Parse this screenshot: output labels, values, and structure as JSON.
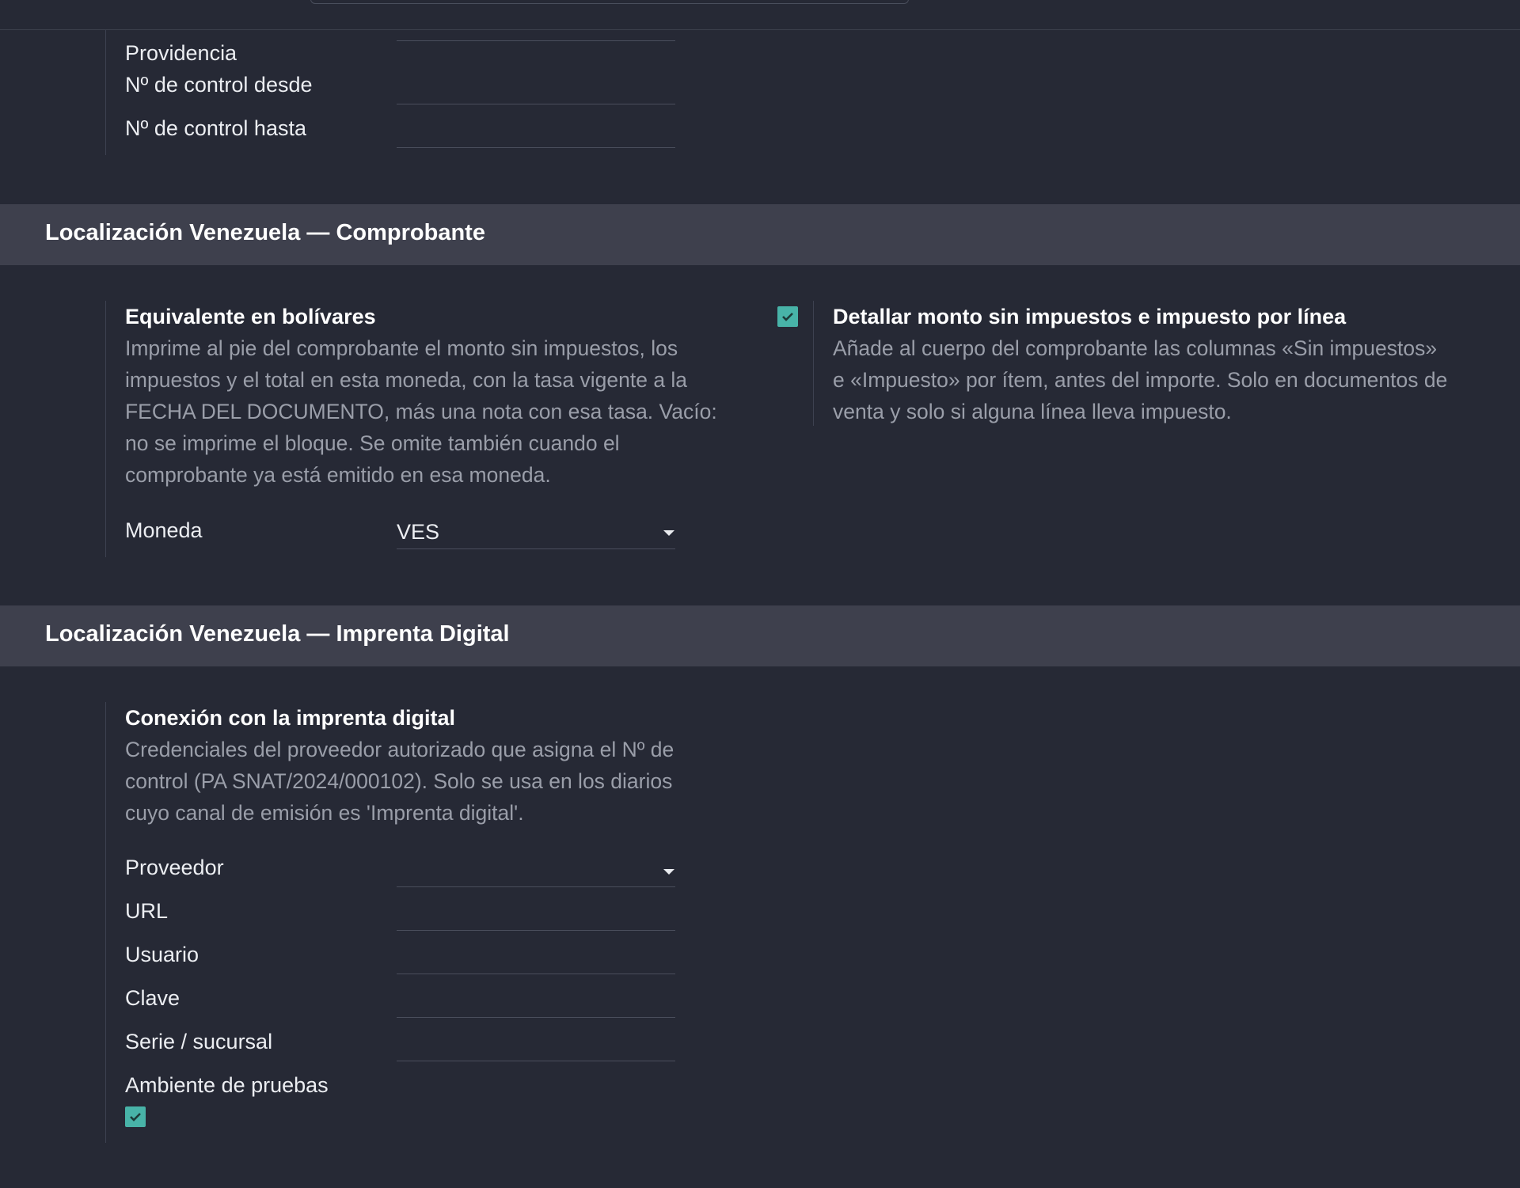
{
  "top_fields": [
    {
      "label": "Providencia"
    },
    {
      "label": "Nº de control desde"
    },
    {
      "label": "Nº de control hasta"
    }
  ],
  "section_comprobante": {
    "header": "Localización Venezuela — Comprobante",
    "bolivares": {
      "title": "Equivalente en bolívares",
      "description": "Imprime al pie del comprobante el monto sin impuestos, los impuestos y el total en esta moneda, con la tasa vigente a la FECHA DEL DOCUMENTO, más una nota con esa tasa. Vacío: no se imprime el bloque. Se omite también cuando el comprobante ya está emitido en esa moneda.",
      "currency_label": "Moneda",
      "currency_value": "VES"
    },
    "detallar": {
      "checked": true,
      "title": "Detallar monto sin impuestos e impuesto por línea",
      "description": "Añade al cuerpo del comprobante las columnas «Sin impuestos» e «Impuesto» por ítem, antes del importe. Solo en documentos de venta y solo si alguna línea lleva impuesto."
    }
  },
  "section_imprenta": {
    "header": "Localización Venezuela — Imprenta Digital",
    "conexion": {
      "title": "Conexión con la imprenta digital",
      "description": "Credenciales del proveedor autorizado que asigna el Nº de control (PA SNAT/2024/000102). Solo se usa en los diarios cuyo canal de emisión es 'Imprenta digital'.",
      "proveedor_label": "Proveedor",
      "proveedor_value": "",
      "url_label": "URL",
      "usuario_label": "Usuario",
      "clave_label": "Clave",
      "serie_label": "Serie / sucursal",
      "ambiente_label": "Ambiente de pruebas",
      "ambiente_checked": true
    }
  },
  "colors": {
    "background": "#262935",
    "section_header": "#3e404d",
    "checkbox_accent": "#48b3a8"
  }
}
